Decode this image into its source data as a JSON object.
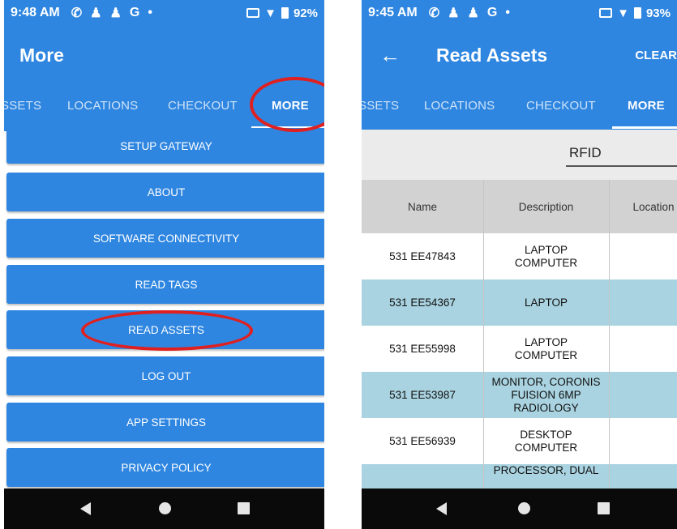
{
  "left_screen": {
    "status": {
      "time": "9:48 AM",
      "icons": [
        "phone-icon",
        "person-icon",
        "person-icon",
        "G",
        "•"
      ],
      "battery": "92%"
    },
    "title": "More",
    "tabs": [
      "SSETS",
      "LOCATIONS",
      "CHECKOUT",
      "MORE"
    ],
    "active_tab": "MORE",
    "menu": [
      "SETUP GATEWAY",
      "ABOUT",
      "SOFTWARE CONNECTIVITY",
      "READ TAGS",
      "READ ASSETS",
      "LOG OUT",
      "APP SETTINGS",
      "PRIVACY POLICY"
    ]
  },
  "right_screen": {
    "status": {
      "time": "9:45 AM",
      "icons": [
        "phone-icon",
        "person-icon",
        "person-icon",
        "G",
        "•"
      ],
      "battery": "93%"
    },
    "title": "Read Assets",
    "clear_label": "CLEAR",
    "tabs": [
      "SSETS",
      "LOCATIONS",
      "CHECKOUT",
      "MORE"
    ],
    "active_tab": "MORE",
    "rfid_label": "RFID",
    "table": {
      "headers": [
        "Name",
        "Description",
        "Location"
      ],
      "rows": [
        {
          "name": "531 EE47843",
          "description": "LAPTOP\nCOMPUTER",
          "location": ""
        },
        {
          "name": "531 EE54367",
          "description": "LAPTOP",
          "location": ""
        },
        {
          "name": "531 EE55998",
          "description": "LAPTOP\nCOMPUTER",
          "location": ""
        },
        {
          "name": "531 EE53987",
          "description": "MONITOR, CORONIS\nFUISION 6MP\nRADIOLOGY",
          "location": ""
        },
        {
          "name": "531 EE56939",
          "description": "DESKTOP\nCOMPUTER",
          "location": ""
        },
        {
          "name": "",
          "description": "PROCESSOR, DUAL",
          "location": ""
        }
      ]
    }
  },
  "colors": {
    "primary": "#2f86e0",
    "highlight_row": "#a9d3e0",
    "annotation_circle": "#e02020",
    "nav_bar": "#0a0a0a"
  }
}
